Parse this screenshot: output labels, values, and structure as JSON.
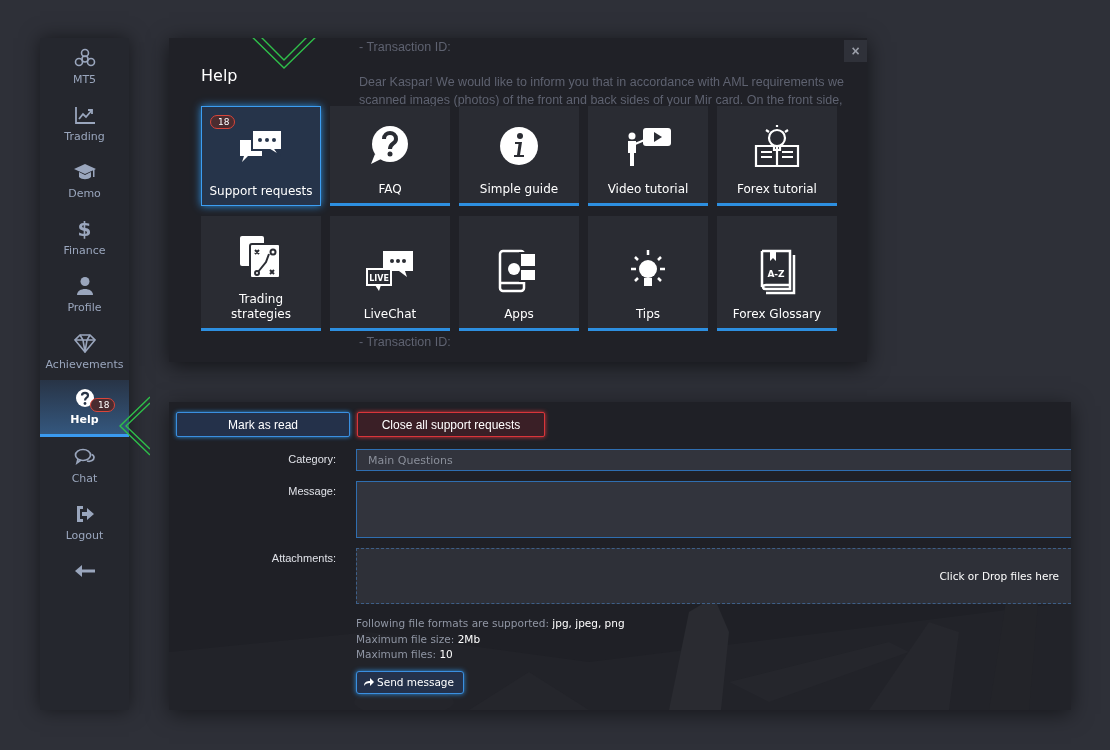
{
  "sidebar": {
    "items": [
      {
        "label": "MT5",
        "selected": false
      },
      {
        "label": "Trading",
        "selected": false
      },
      {
        "label": "Demo",
        "selected": false
      },
      {
        "label": "Finance",
        "selected": false,
        "icon_char": "$"
      },
      {
        "label": "Profile",
        "selected": false
      },
      {
        "label": "Achievements",
        "selected": false
      },
      {
        "label": "Help",
        "selected": true,
        "badge": "18"
      },
      {
        "label": "Chat",
        "selected": false
      },
      {
        "label": "Logout",
        "selected": false
      },
      {
        "selected": false
      }
    ]
  },
  "help_modal": {
    "title": "Help",
    "close": "×",
    "background_text": [
      "- Transaction ID:",
      "Dear Kaspar! We would like to inform you that in accordance with AML requirements we",
      "scanned images (photos) of the front and back sides of your Mir card. On the front side,"
    ],
    "background_text_bottom": "- Transaction ID:",
    "tiles": [
      {
        "label": "Support requests",
        "selected": true,
        "badge": "18"
      },
      {
        "label": "FAQ",
        "selected": false
      },
      {
        "label": "Simple guide",
        "selected": false
      },
      {
        "label": "Video tutorial",
        "selected": false
      },
      {
        "label": "Forex tutorial",
        "selected": false
      },
      {
        "label": "Trading strategies",
        "selected": false
      },
      {
        "label": "LiveChat",
        "selected": false,
        "icon_text": "LIVE"
      },
      {
        "label": "Apps",
        "selected": false
      },
      {
        "label": "Tips",
        "selected": false
      },
      {
        "label": "Forex Glossary",
        "selected": false,
        "icon_text": "A-Z"
      }
    ]
  },
  "support_form": {
    "buttons": [
      {
        "label": "Mark as read",
        "kind": "primary"
      },
      {
        "label": "Close all support requests",
        "kind": "danger"
      }
    ],
    "category": {
      "label": "Category:",
      "value": "Main Questions"
    },
    "message": {
      "label": "Message:"
    },
    "attachments": {
      "label": "Attachments:",
      "dropzone": "Click or Drop files here"
    },
    "info": [
      "Following file formats are supported: **jpg, jpeg, png**",
      "Maximum file size: **2Mb**",
      "Maximum files: **10**"
    ],
    "send_button": "Send message"
  }
}
